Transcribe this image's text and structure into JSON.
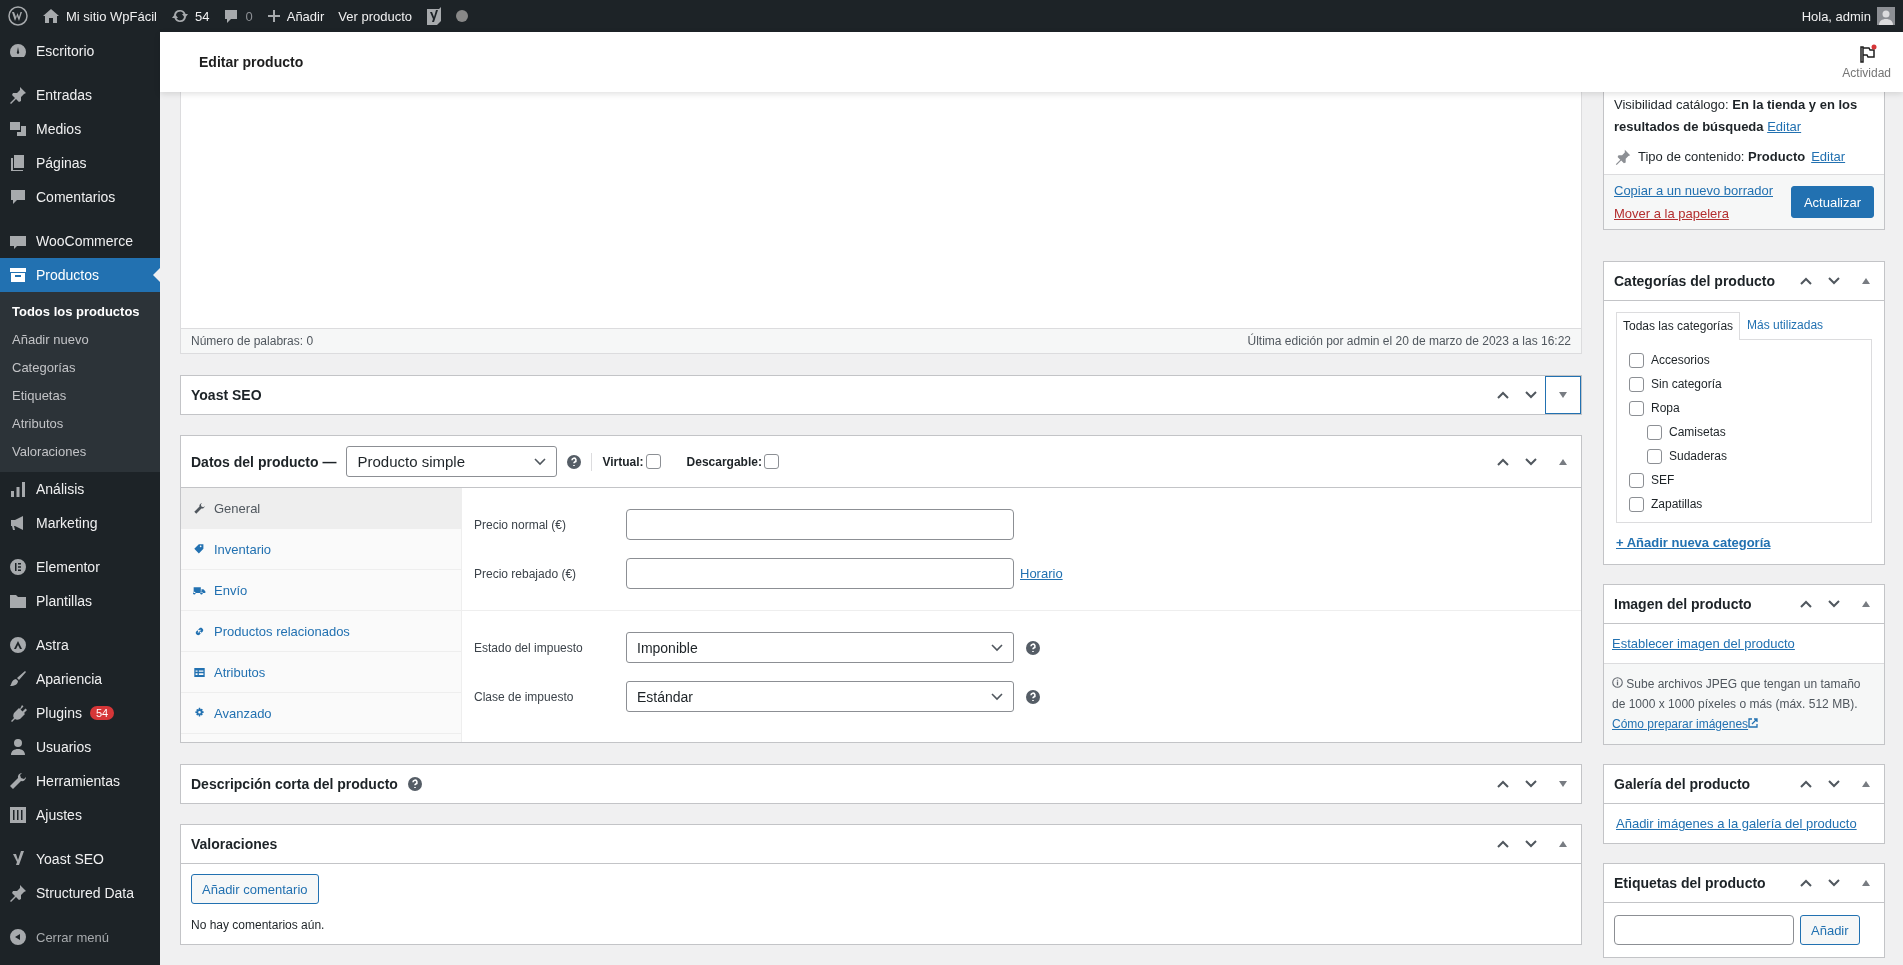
{
  "admin_bar": {
    "site_name": "Mi sitio WpFácil",
    "updates": "54",
    "comments": "0",
    "new": "Añadir",
    "view": "Ver producto",
    "greeting": "Hola, admin"
  },
  "sidebar": {
    "groups": [
      [
        {
          "label": "Escritorio",
          "selected": false
        }
      ],
      [
        {
          "label": "Entradas",
          "selected": false
        },
        {
          "label": "Medios",
          "selected": false
        },
        {
          "label": "Páginas",
          "selected": false
        },
        {
          "label": "Comentarios",
          "selected": false
        }
      ],
      [
        {
          "label": "WooCommerce",
          "selected": false
        },
        {
          "label": "Productos",
          "selected": true,
          "submenu": [
            {
              "label": "Todos los productos",
              "selected": true
            },
            {
              "label": "Añadir nuevo",
              "selected": false
            },
            {
              "label": "Categorías",
              "selected": false
            },
            {
              "label": "Etiquetas",
              "selected": false
            },
            {
              "label": "Atributos",
              "selected": false
            },
            {
              "label": "Valoraciones",
              "selected": false
            }
          ]
        },
        {
          "label": "Análisis",
          "selected": false
        },
        {
          "label": "Marketing",
          "selected": false
        }
      ],
      [
        {
          "label": "Elementor",
          "selected": false
        },
        {
          "label": "Plantillas",
          "selected": false
        }
      ],
      [
        {
          "label": "Astra",
          "selected": false
        },
        {
          "label": "Apariencia",
          "selected": false
        },
        {
          "label": "Plugins",
          "selected": false,
          "badge": "54"
        },
        {
          "label": "Usuarios",
          "selected": false
        },
        {
          "label": "Herramientas",
          "selected": false
        },
        {
          "label": "Ajustes",
          "selected": false
        }
      ],
      [
        {
          "label": "Yoast SEO",
          "selected": false
        },
        {
          "label": "Structured Data",
          "selected": false
        }
      ]
    ],
    "collapse": "Cerrar menú"
  },
  "header": {
    "title": "Editar producto",
    "activity": "Actividad"
  },
  "editor": {
    "word_count": "Número de palabras: 0",
    "last_edit": "Última edición por admin el 20 de marzo de 2023 a las 16:22"
  },
  "yoast": {
    "title": "Yoast SEO",
    "expanded": false,
    "focused": true
  },
  "product_data": {
    "title": "Datos del producto —",
    "type": "Producto simple",
    "help": true,
    "expanded": true,
    "options": [
      {
        "label": "Virtual:",
        "checked": false
      },
      {
        "label": "Descargable:",
        "checked": false
      }
    ],
    "tabs": [
      {
        "label": "General",
        "selected": true
      },
      {
        "label": "Inventario",
        "selected": false
      },
      {
        "label": "Envío",
        "selected": false
      },
      {
        "label": "Productos relacionados",
        "selected": false
      },
      {
        "label": "Atributos",
        "selected": false
      },
      {
        "label": "Avanzado",
        "selected": false
      }
    ],
    "sections": [
      [
        {
          "label": "Precio normal (€)",
          "kind": "input"
        },
        {
          "label": "Precio rebajado (€)",
          "kind": "input",
          "link": "Horario"
        }
      ],
      [
        {
          "label": "Estado del impuesto",
          "kind": "select",
          "value": "Imponible",
          "help": true
        },
        {
          "label": "Clase de impuesto",
          "kind": "select",
          "value": "Estándar",
          "help": true
        }
      ]
    ]
  },
  "short_description": {
    "title": "Descripción corta del producto",
    "help": true,
    "expanded": false
  },
  "reviews": {
    "title": "Valoraciones",
    "expanded": true,
    "button": "Añadir comentario",
    "empty": "No hay comentarios aún."
  },
  "publish": {
    "visibility": "Visibilidad catálogo: **En la tienda y en los resultados de búsqueda**",
    "visibility_edit": "Editar",
    "content_type": "Tipo de contenido: **Producto**",
    "content_type_edit": "Editar",
    "copy": "Copiar a un nuevo borrador",
    "trash": "Mover a la papelera",
    "update": "Actualizar"
  },
  "categories": {
    "title": "Categorías del producto",
    "expanded": true,
    "tabs": [
      {
        "label": "Todas las categorías",
        "selected": true
      },
      {
        "label": "Más utilizadas",
        "selected": false
      }
    ],
    "items": [
      {
        "label": "Accesorios",
        "checked": false
      },
      {
        "label": "Sin categoría",
        "checked": false
      },
      {
        "label": "Ropa",
        "checked": false,
        "children": [
          {
            "label": "Camisetas",
            "checked": false
          },
          {
            "label": "Sudaderas",
            "checked": false
          }
        ]
      },
      {
        "label": "SEF",
        "checked": false
      },
      {
        "label": "Zapatillas",
        "checked": false
      }
    ],
    "add": "+ Añadir nueva categoría"
  },
  "image": {
    "title": "Imagen del producto",
    "expanded": true,
    "link": "Establecer imagen del producto",
    "note": "Sube archivos JPEG que tengan un tamaño de 1000 x 1000 píxeles o más (máx. 512 MB).",
    "note_link": "Cómo preparar imágenes"
  },
  "gallery": {
    "title": "Galería del producto",
    "expanded": true,
    "link": "Añadir imágenes a la galería del producto"
  },
  "tags": {
    "title": "Etiquetas del producto",
    "expanded": true,
    "button": "Añadir"
  }
}
